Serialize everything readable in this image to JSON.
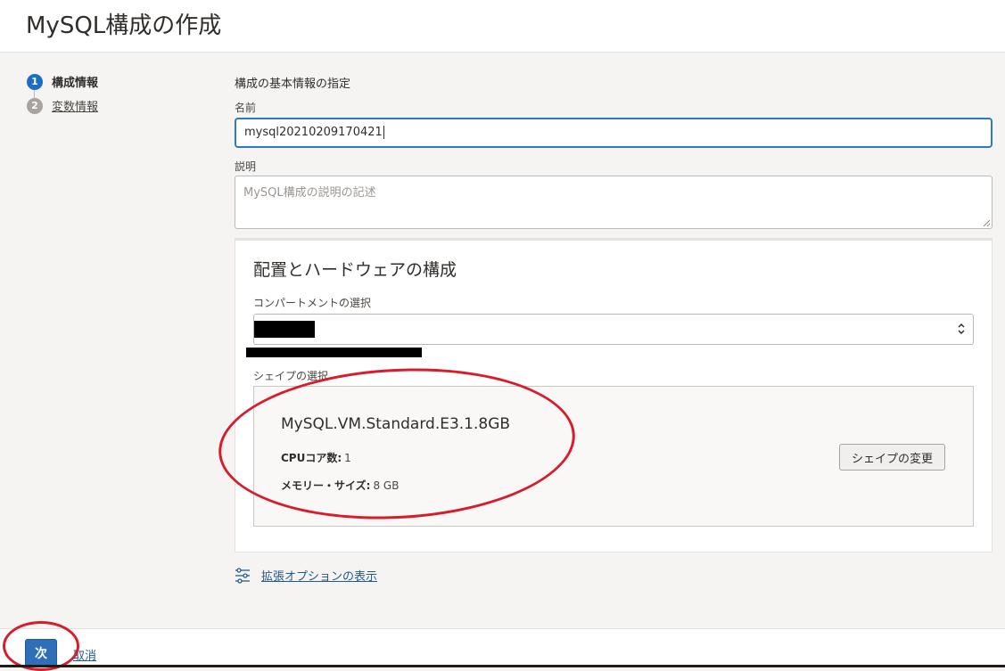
{
  "page": {
    "title": "MySQL構成の作成"
  },
  "steps": [
    {
      "number": "1",
      "label": "構成情報",
      "state": "active"
    },
    {
      "number": "2",
      "label": "変数情報",
      "state": "inactive"
    }
  ],
  "form": {
    "section_label": "構成の基本情報の指定",
    "name": {
      "label": "名前",
      "value": "mysql20210209170421"
    },
    "description": {
      "label": "説明",
      "placeholder": "MySQL構成の説明の記述",
      "value": ""
    }
  },
  "placement": {
    "title": "配置とハードウェアの構成",
    "compartment": {
      "label": "コンパートメントの選択"
    },
    "shape": {
      "label": "シェイプの選択",
      "name": "MySQL.VM.Standard.E3.1.8GB",
      "cpu_label": "CPUコア数:",
      "cpu_value": "1",
      "memory_label": "メモリー・サイズ:",
      "memory_value": "8 GB",
      "change_button": "シェイプの変更"
    }
  },
  "advanced_options": {
    "link": "拡張オプションの表示"
  },
  "footer": {
    "next_button": "次",
    "cancel_link": "取消"
  },
  "colors": {
    "accent": "#2f6fb8",
    "link": "#24598c",
    "annotation": "#d71d2b",
    "step_active": "#1b6ec2",
    "step_inactive": "#a8a39e"
  },
  "icons": {
    "compartment_select": "chevron-updown-icon",
    "advanced_options": "sliders-icon"
  }
}
